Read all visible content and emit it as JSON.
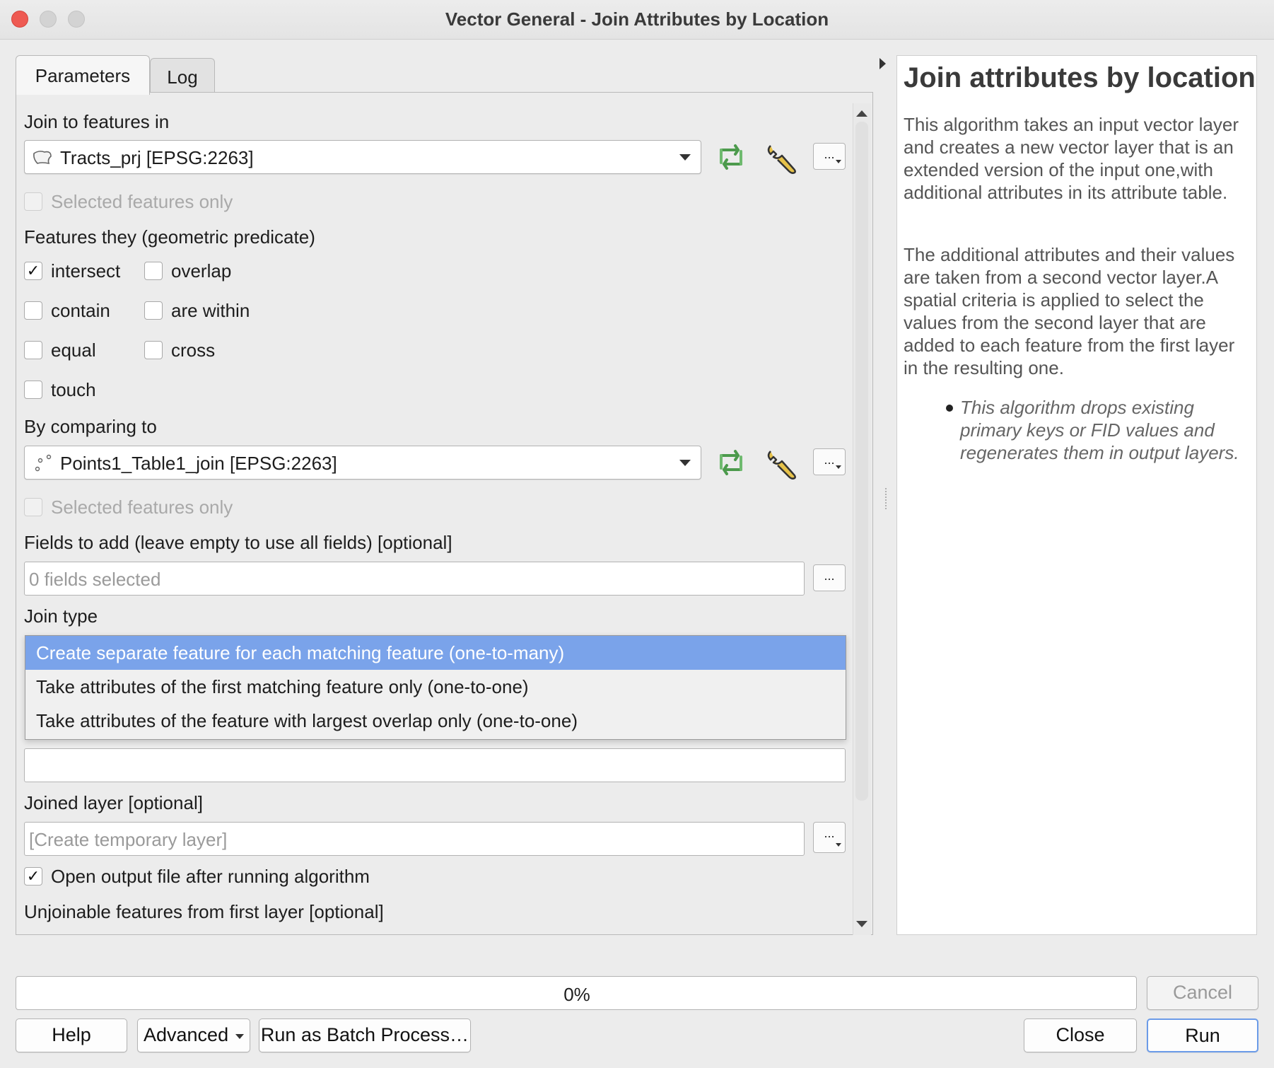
{
  "window": {
    "title": "Vector General - Join Attributes by Location"
  },
  "tabs": [
    "Parameters",
    "Log"
  ],
  "params": {
    "join_to_label": "Join to features in",
    "join_to_layer": "Tracts_prj [EPSG:2263]",
    "selected_only_label": "Selected features only",
    "predicate_label": "Features they (geometric predicate)",
    "predicates": [
      {
        "label": "intersect",
        "checked": true
      },
      {
        "label": "overlap",
        "checked": false
      },
      {
        "label": "contain",
        "checked": false
      },
      {
        "label": "are within",
        "checked": false
      },
      {
        "label": "equal",
        "checked": false
      },
      {
        "label": "cross",
        "checked": false
      },
      {
        "label": "touch",
        "checked": false
      }
    ],
    "compare_label": "By comparing to",
    "compare_layer": "Points1_Table1_join [EPSG:2263]",
    "selected_only_label_2": "Selected features only",
    "fields_label": "Fields to add (leave empty to use all fields) [optional]",
    "fields_placeholder": "0 fields selected",
    "join_type_label": "Join type",
    "join_type_options": [
      "Create separate feature for each matching feature (one-to-many)",
      "Take attributes of the first matching feature only (one-to-one)",
      "Take attributes of the feature with largest overlap only (one-to-one)"
    ],
    "join_type_selected_index": 0,
    "joined_layer_label": "Joined layer [optional]",
    "joined_layer_placeholder": "[Create temporary layer]",
    "open_output_label": "Open output file after running algorithm",
    "open_output_checked": true,
    "unjoinable_label": "Unjoinable features from first layer [optional]",
    "more_button": "..."
  },
  "help": {
    "title": "Join attributes by location",
    "paragraph1": "This algorithm takes an input vector layer and creates a new vector layer that is an extended version of the input one,with additional attributes in its attribute table.",
    "paragraph2": "The additional attributes and their values are taken from a second vector layer.A spatial criteria is applied to select the values from the second layer that are added to each feature from the first layer in the resulting one.",
    "bullet": "This algorithm drops existing primary keys or FID values and regenerates them in output layers."
  },
  "progress": {
    "value": 0,
    "text": "0%"
  },
  "buttons": {
    "cancel": "Cancel",
    "help": "Help",
    "advanced": "Advanced",
    "batch": "Run as Batch Process…",
    "close": "Close",
    "run": "Run"
  },
  "icons": {
    "polygon_layer": "polygon-layer-icon",
    "point_layer": "point-layer-icon",
    "iterate": "iterate-icon",
    "settings": "wrench-icon"
  },
  "colors": {
    "selection": "#7aa3ea",
    "iterate_green": "#5aa65a",
    "close_red": "#ee5a52"
  }
}
